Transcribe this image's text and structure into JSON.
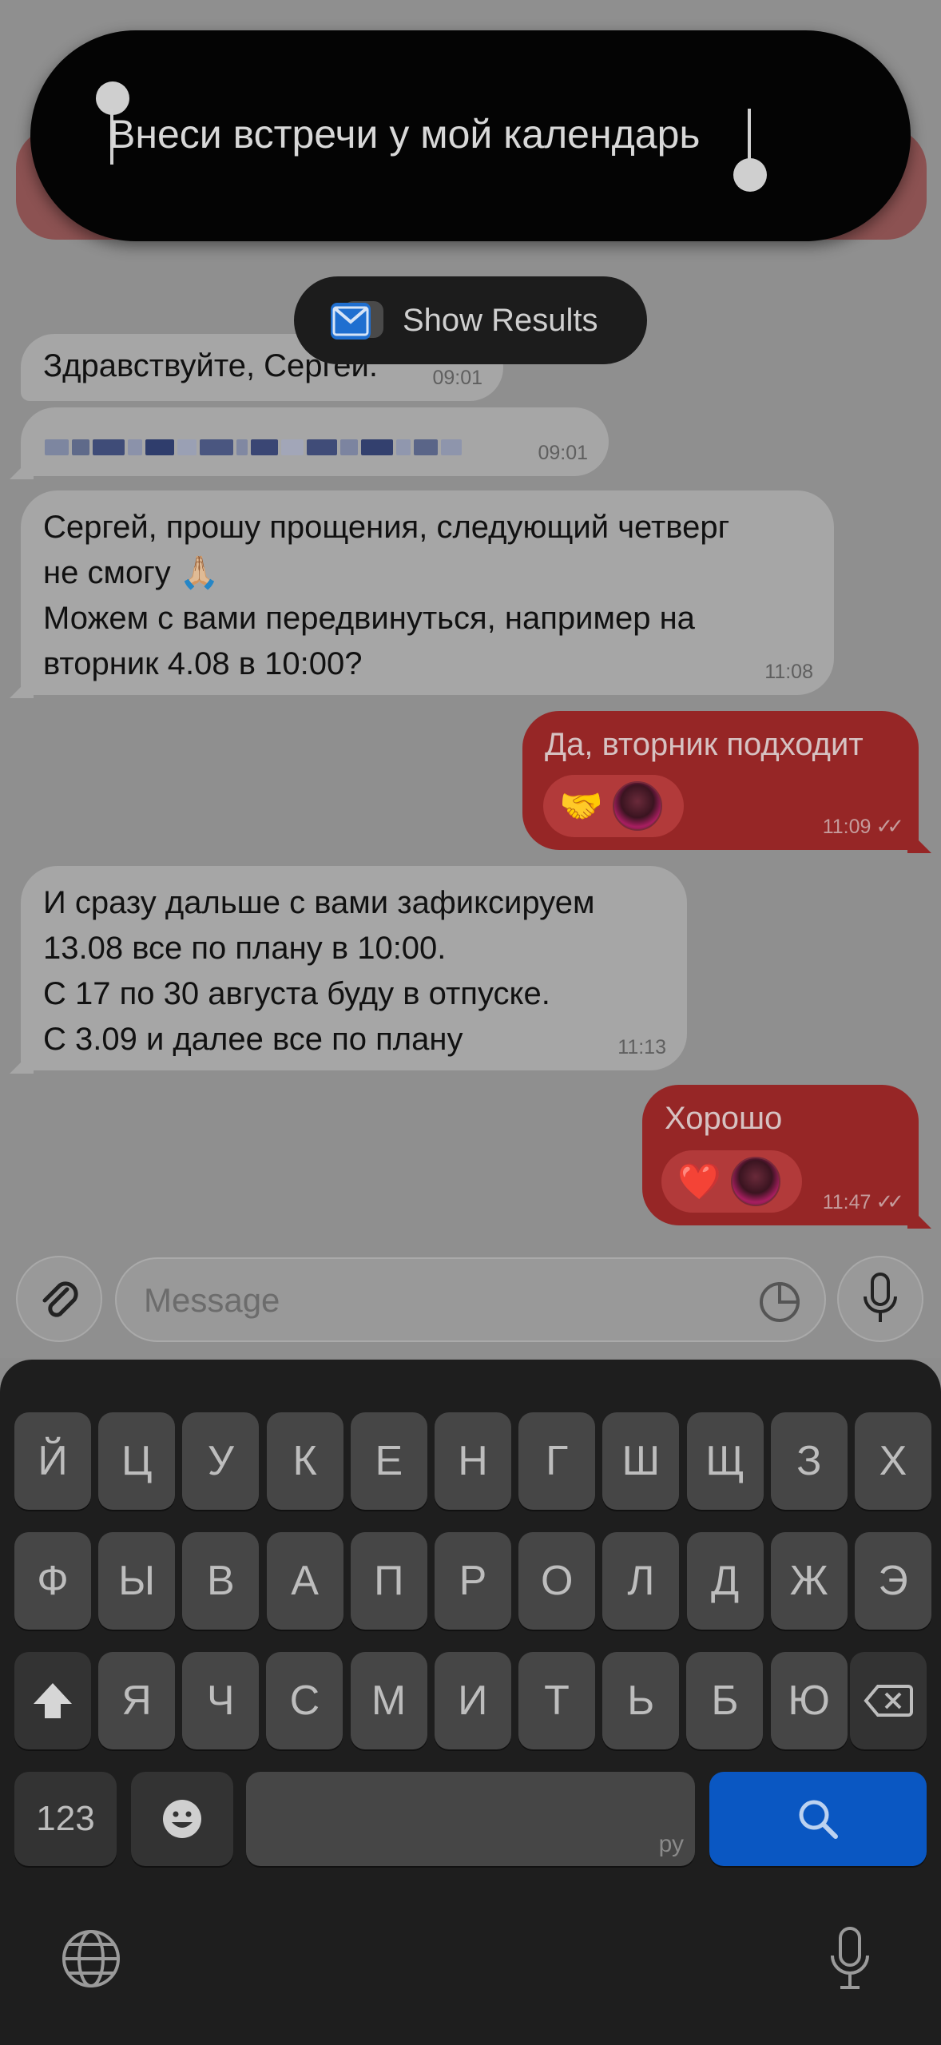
{
  "command": {
    "text": "Внеси встречи у мой календарь",
    "show_results_label": "Show Results"
  },
  "messages": [
    {
      "dir": "in",
      "text": "Здравствуйте, Сергей.",
      "time": "09:01"
    },
    {
      "dir": "in",
      "text": "",
      "time": "09:01",
      "redacted": true
    },
    {
      "dir": "in",
      "lines": [
        "Сергей, прошу прощения, следующий четверг",
        "не смогу 🙏🏼",
        "Можем с вами передвинуться, например на",
        "вторник 4.08 в 10:00?"
      ],
      "time": "11:08"
    },
    {
      "dir": "out",
      "text": "Да, вторник подходит",
      "time": "11:09",
      "reaction": "🤝"
    },
    {
      "dir": "in",
      "lines": [
        "И сразу дальше с вами зафиксируем",
        "13.08 все по плану в 10:00.",
        "С 17 по 30 августа буду в отпуске.",
        "С 3.09 и далее все по плану"
      ],
      "time": "11:13"
    },
    {
      "dir": "out",
      "text": "Хорошо",
      "time": "11:47",
      "reaction": "❤️"
    }
  ],
  "composer": {
    "placeholder": "Message"
  },
  "keyboard": {
    "row1": [
      "Й",
      "Ц",
      "У",
      "К",
      "Е",
      "Н",
      "Г",
      "Ш",
      "Щ",
      "З",
      "Х"
    ],
    "row2": [
      "Ф",
      "Ы",
      "В",
      "А",
      "П",
      "Р",
      "О",
      "Л",
      "Д",
      "Ж",
      "Э"
    ],
    "row3": [
      "Я",
      "Ч",
      "С",
      "М",
      "И",
      "Т",
      "Ь",
      "Б",
      "Ю"
    ],
    "numbers_label": "123",
    "space_lang": "ру"
  },
  "colors": {
    "outgoing_bubble": "#962626",
    "incoming_bubble": "#a6a6a6",
    "search_key": "#0a57c2"
  }
}
